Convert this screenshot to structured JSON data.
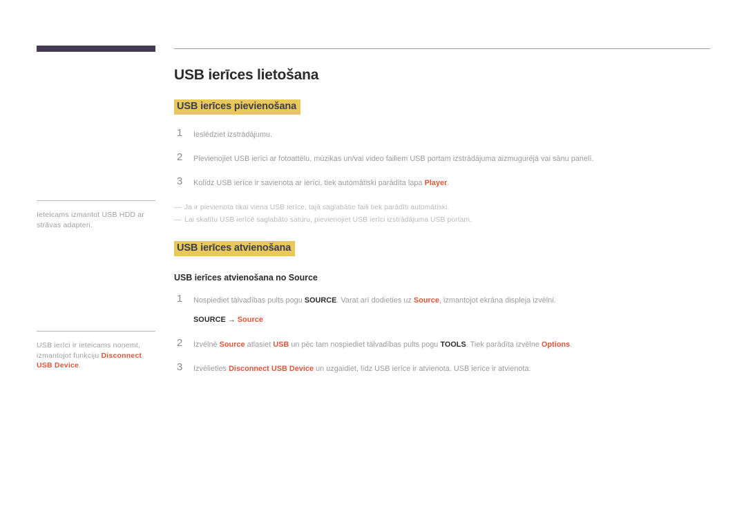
{
  "page": {
    "title": "USB ierīces lietošana",
    "accent_yellow": "#e8c85a",
    "accent_red": "#e0543a",
    "corner_bar_color": "#453a52"
  },
  "sidebar": {
    "notes": [
      {
        "text": "Ieteicams izmantot USB HDD ar strāvas adapteri."
      },
      {
        "text_before": "USB ierīci ir ieteicams noņemt, izmantojot funkciju ",
        "keyword": "Disconnect USB Device",
        "text_after": "."
      }
    ]
  },
  "sections": [
    {
      "heading": "USB ierīces pievienošana",
      "steps": [
        {
          "num": "1",
          "text": "Ieslēdziet izstrādājumu."
        },
        {
          "num": "2",
          "text": "Pievienojiet USB ierīci ar fotoattēlu, mūzikas un/vai video failiem USB portam izstrādājuma aizmugurējā vai sānu panelī."
        },
        {
          "num": "3",
          "text_before": "Kolīdz USB ierīce ir savienota ar ierīci, tiek automātiski parādīta lapa ",
          "keyword": "Player",
          "text_after": "."
        }
      ],
      "notes": [
        {
          "dash": "—",
          "text": "Ja ir pievienota tikai viena USB ierīce, tajā saglabātie faili tiek parādīti automātiski."
        },
        {
          "dash": "—",
          "text": "Lai skatītu USB ierīcē saglabāto saturu, pievienojiet USB ierīci izstrādājuma USB portam."
        }
      ]
    },
    {
      "heading": "USB ierīces atvienošana",
      "subheading": "USB ierīces atvienošana no Source",
      "steps": [
        {
          "num": "1",
          "text_part1": "Nospiediet tālvadības pults pogu ",
          "bold1": "SOURCE",
          "text_part2": ". Varat arī dodieties uz ",
          "keyword1": "Source",
          "text_part3": ", izmantojot ekrāna displeja izvēlni.",
          "path": {
            "key": "SOURCE",
            "arrow": "→",
            "value": "Source"
          }
        },
        {
          "num": "2",
          "text_part1": "Izvēlnē ",
          "keyword1": "Source",
          "text_part2": " atlasiet ",
          "keyword2": "USB",
          "text_part3": " un pēc tam nospiediet tālvadības pults pogu ",
          "bold1": "TOOLS",
          "text_part4": ". Tiek parādīta izvēlne ",
          "keyword3": "Options",
          "text_part5": "."
        },
        {
          "num": "3",
          "text_part1": "Izvēlieties ",
          "keyword1": "Disconnect USB Device",
          "text_part2": " un uzgaidiet, līdz USB ierīce ir atvienota. USB ierīce ir atvienota."
        }
      ]
    }
  ]
}
